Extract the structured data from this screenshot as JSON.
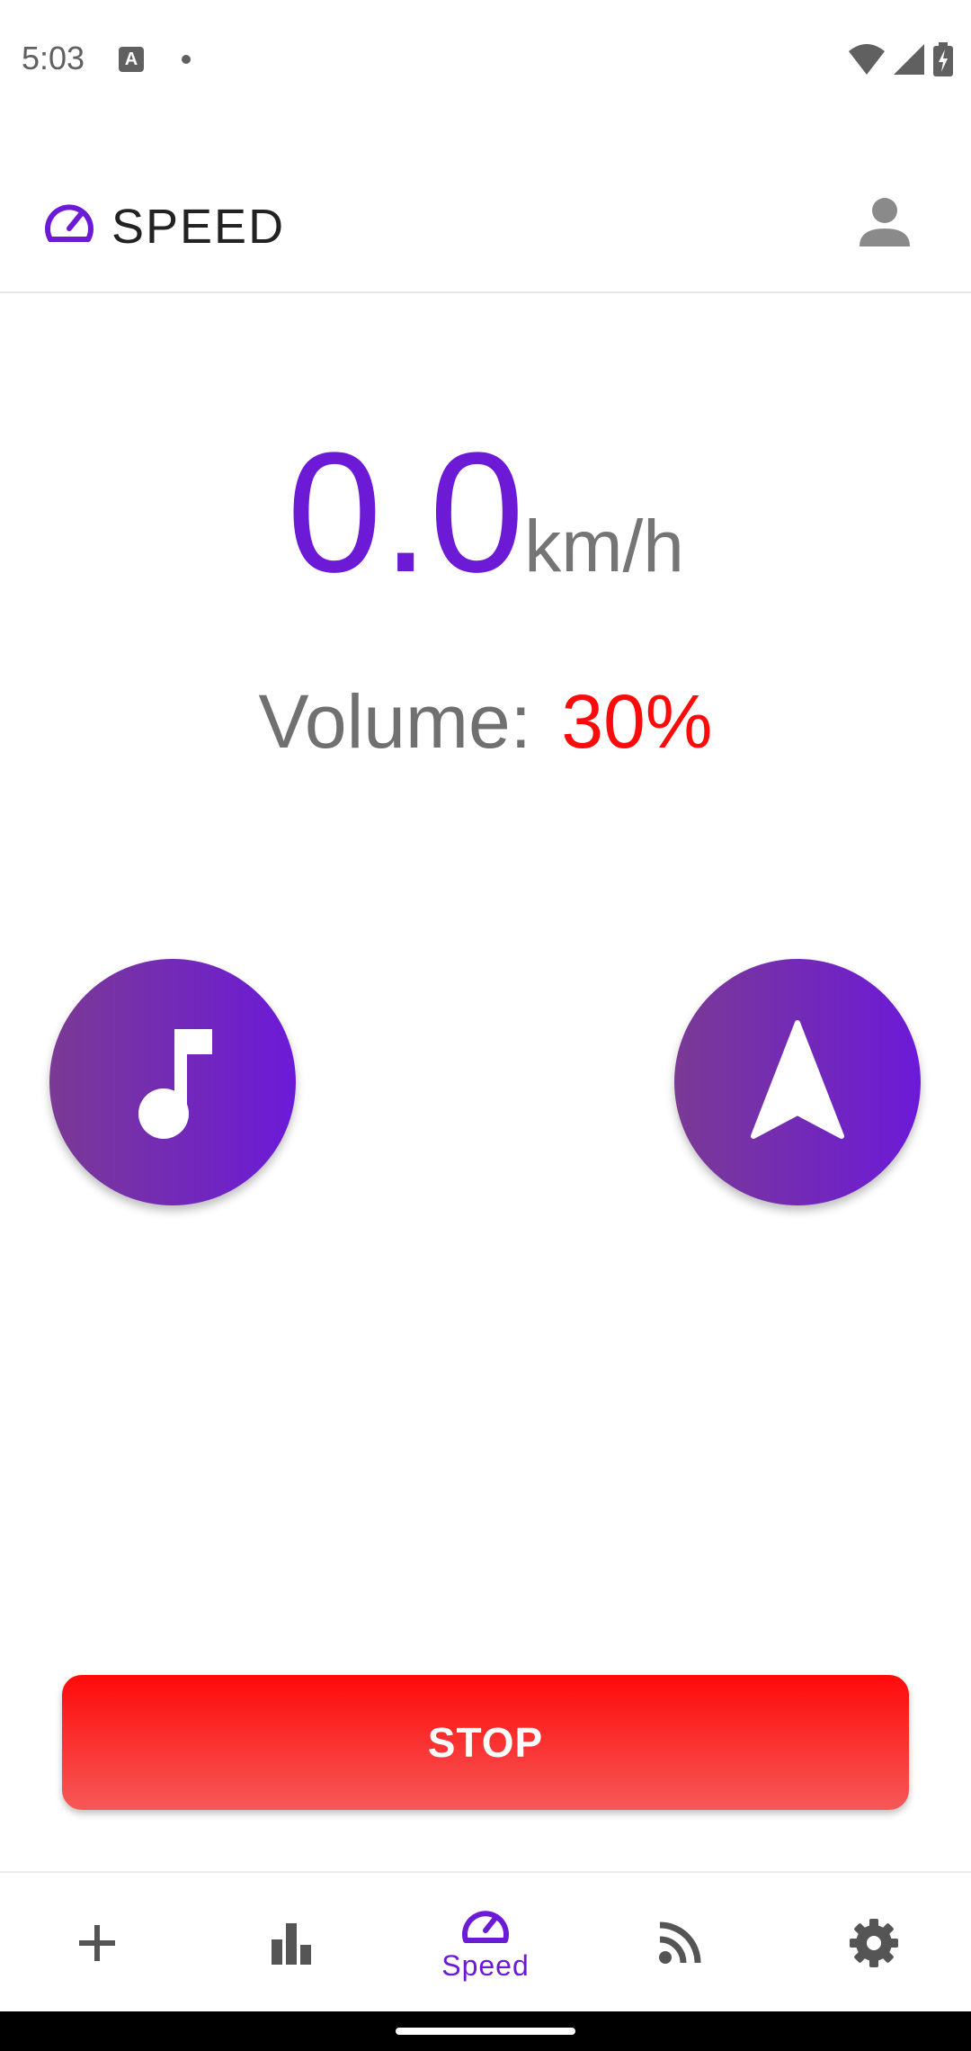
{
  "status_bar": {
    "time": "5:03",
    "notification_icon": "a-icon",
    "icons": [
      "wifi-icon",
      "signal-icon",
      "battery-charging-icon"
    ]
  },
  "app_bar": {
    "title": "SPEED",
    "logo_icon": "speedometer-icon",
    "profile_icon": "person-icon"
  },
  "speed": {
    "value": "0.0",
    "unit": "km/h"
  },
  "volume": {
    "label": "Volume:",
    "value": "30%"
  },
  "actions": {
    "music_icon": "music-note-icon",
    "navigation_icon": "navigation-arrow-icon",
    "stop_label": "STOP"
  },
  "bottom_nav": {
    "items": [
      {
        "icon": "plus-icon",
        "label": "",
        "active": false
      },
      {
        "icon": "bar-chart-icon",
        "label": "",
        "active": false
      },
      {
        "icon": "speedometer-icon",
        "label": "Speed",
        "active": true
      },
      {
        "icon": "rss-feed-icon",
        "label": "",
        "active": false
      },
      {
        "icon": "gear-icon",
        "label": "",
        "active": false
      }
    ]
  },
  "colors": {
    "accent": "#6c1ad6",
    "danger": "#ff0a0a",
    "gradient_start": "#7a3a94",
    "gradient_end": "#6c1ad8"
  }
}
